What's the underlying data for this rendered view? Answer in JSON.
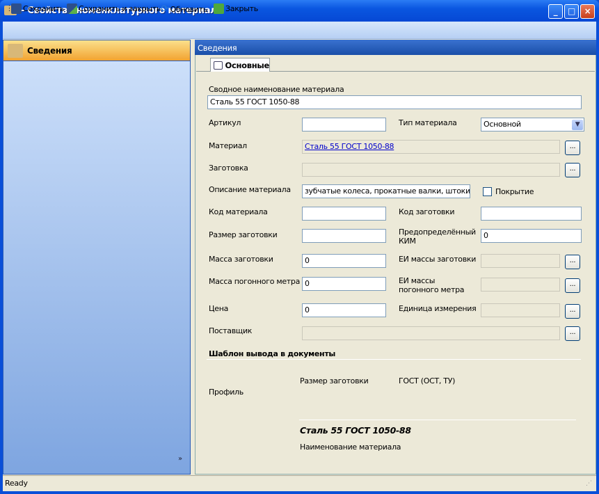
{
  "window": {
    "title": "- Свойства номенклатурного материала"
  },
  "toolbar": {
    "save": "Сохранить",
    "save_close": "Сохранить и закрыть",
    "refresh": "Обновить",
    "close": "Закрыть"
  },
  "sidebar": {
    "item": "Сведения"
  },
  "panel": {
    "header": "Сведения",
    "tab": "Основные"
  },
  "form": {
    "summary_label": "Сводное наименование материала",
    "summary_value": "Сталь 55 ГОСТ 1050-88",
    "article_label": "Артикул",
    "article_value": "",
    "type_label": "Тип материала",
    "type_value": "Основной",
    "material_label": "Материал",
    "material_value": "Сталь 55 ГОСТ 1050-88",
    "blank_label": "Заготовка",
    "blank_value": "",
    "desc_label": "Описание материала",
    "desc_value": "зубчатые колеса, прокатные валки, штоки и д",
    "coating_label": "Покрытие",
    "coating_checked": false,
    "mat_code_label": "Код материала",
    "mat_code_value": "",
    "blank_code_label": "Код заготовки",
    "blank_code_value": "",
    "blank_size_label": "Размер заготовки",
    "blank_size_value": "",
    "kim_label": "Предопределённый КИМ",
    "kim_value": "0",
    "blank_mass_label": "Масса заготовки",
    "blank_mass_value": "0",
    "blank_mass_unit_label": "ЕИ массы заготовки",
    "blank_mass_unit_value": "",
    "meter_mass_label": "Масса погонного метра",
    "meter_mass_value": "0",
    "meter_mass_unit_label": "ЕИ массы погонного метра",
    "meter_mass_unit_value": "",
    "price_label": "Цена",
    "price_value": "0",
    "unit_label": "Единица измерения",
    "unit_value": "",
    "supplier_label": "Поставщик",
    "supplier_value": "",
    "browse": "..."
  },
  "template": {
    "heading": "Шаблон вывода в документы",
    "profile": "Профиль",
    "size": "Размер заготовки",
    "gost": "ГОСТ (ОСТ, ТУ)",
    "name_value": "Сталь 55 ГОСТ 1050-88",
    "name_label": "Наименование материала"
  },
  "status": {
    "text": "Ready"
  }
}
